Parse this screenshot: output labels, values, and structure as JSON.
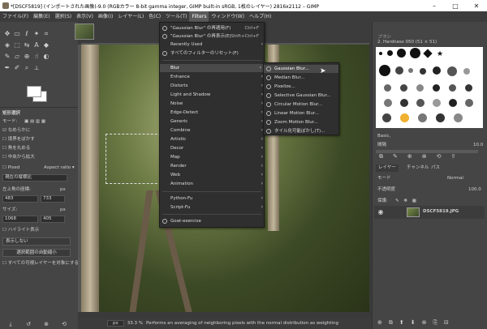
{
  "window": {
    "title": "*[DSCF5819] (インポートされた画像)-9.0 (RGBカラー 8-bit gamma integer, GIMP built-in sRGB, 1枚のレイヤー) 2816x2112 – GIMP",
    "minimize": "–",
    "maximize": "□",
    "close": "✕"
  },
  "menubar": [
    {
      "label": "ファイル(F)"
    },
    {
      "label": "編集(E)"
    },
    {
      "label": "選択(S)"
    },
    {
      "label": "表示(V)"
    },
    {
      "label": "画像(I)"
    },
    {
      "label": "レイヤー(L)"
    },
    {
      "label": "色(C)"
    },
    {
      "label": "ツール(T)"
    },
    {
      "label": "Filters"
    },
    {
      "label": "ウィンドウ(W)"
    },
    {
      "label": "ヘルプ(H)"
    }
  ],
  "filters_menu": {
    "repeat": {
      "label": "\"Gaussian Blur\" の再適用(F)",
      "accel": "Ctrl+F"
    },
    "reshow": {
      "label": "\"Gaussian Blur\" の再表示(E)",
      "accel": "Shift+Ctrl+F"
    },
    "recent": {
      "label": "Recently Used"
    },
    "reset": {
      "label": "すべてのフィルターのリセット(F)"
    },
    "groups": [
      "Blur",
      "Enhance",
      "Distorts",
      "Light and Shadow",
      "Noise",
      "Edge-Detect",
      "Generic",
      "Combine",
      "Artistic",
      "Decor",
      "Map",
      "Render",
      "Web",
      "Animation"
    ],
    "python": "Python-Fu",
    "script": "Script-Fu",
    "goat": "Goat-exercise"
  },
  "blur_menu": [
    "Gaussian Blur...",
    "Median Blur...",
    "Pixelize...",
    "Selective Gaussian Blur...",
    "Circular Motion Blur...",
    "Linear Motion Blur...",
    "Zoom Motion Blur...",
    "タイル化可能ぼかし(T)..."
  ],
  "tool_options": {
    "title": "矩形選択",
    "mode": "モード:",
    "antialias": "なめらかに",
    "feather": "境界をぼかす",
    "rounded": "角を丸める",
    "expand": "中央から拡大",
    "fixed": "Pixed",
    "aspect": "Aspect ratio",
    "current": "現在の縦横比",
    "position_label": "左上角の座標:",
    "pos_x": "483",
    "pos_y": "733",
    "unit": "px",
    "size_label": "サイズ:",
    "size_w": "1068",
    "size_h": "405",
    "highlight": "ハイライト表示",
    "guides": "表示しない",
    "auto_shrink": "選択範囲の自動縮小",
    "merged": "すべての可視レイヤーを対象にする"
  },
  "status": {
    "unit": "px",
    "zoom": "33.3 %",
    "message": "Performs an averaging of neighboring pixels with the normal distribution as weighting"
  },
  "brushes": {
    "title": "ブラシ",
    "selected": "2. Hardness 050 (51 × 51)",
    "category": "Basic,",
    "spacing_label": "間隔",
    "spacing_value": "10.0"
  },
  "layers": {
    "tab_layers": "レイヤー",
    "tab_channels": "チャンネル",
    "tab_paths": "パス",
    "mode_label": "モード",
    "mode_value": "Normal",
    "opacity_label": "不透明度",
    "opacity_value": "100.0",
    "lock_label": "保護:",
    "layer_name": "DSCF5819.JPG"
  },
  "colors": {
    "menu_bg": "#2f2f2f",
    "highlight": "#4a4a4a",
    "dock_bg": "#454545"
  }
}
